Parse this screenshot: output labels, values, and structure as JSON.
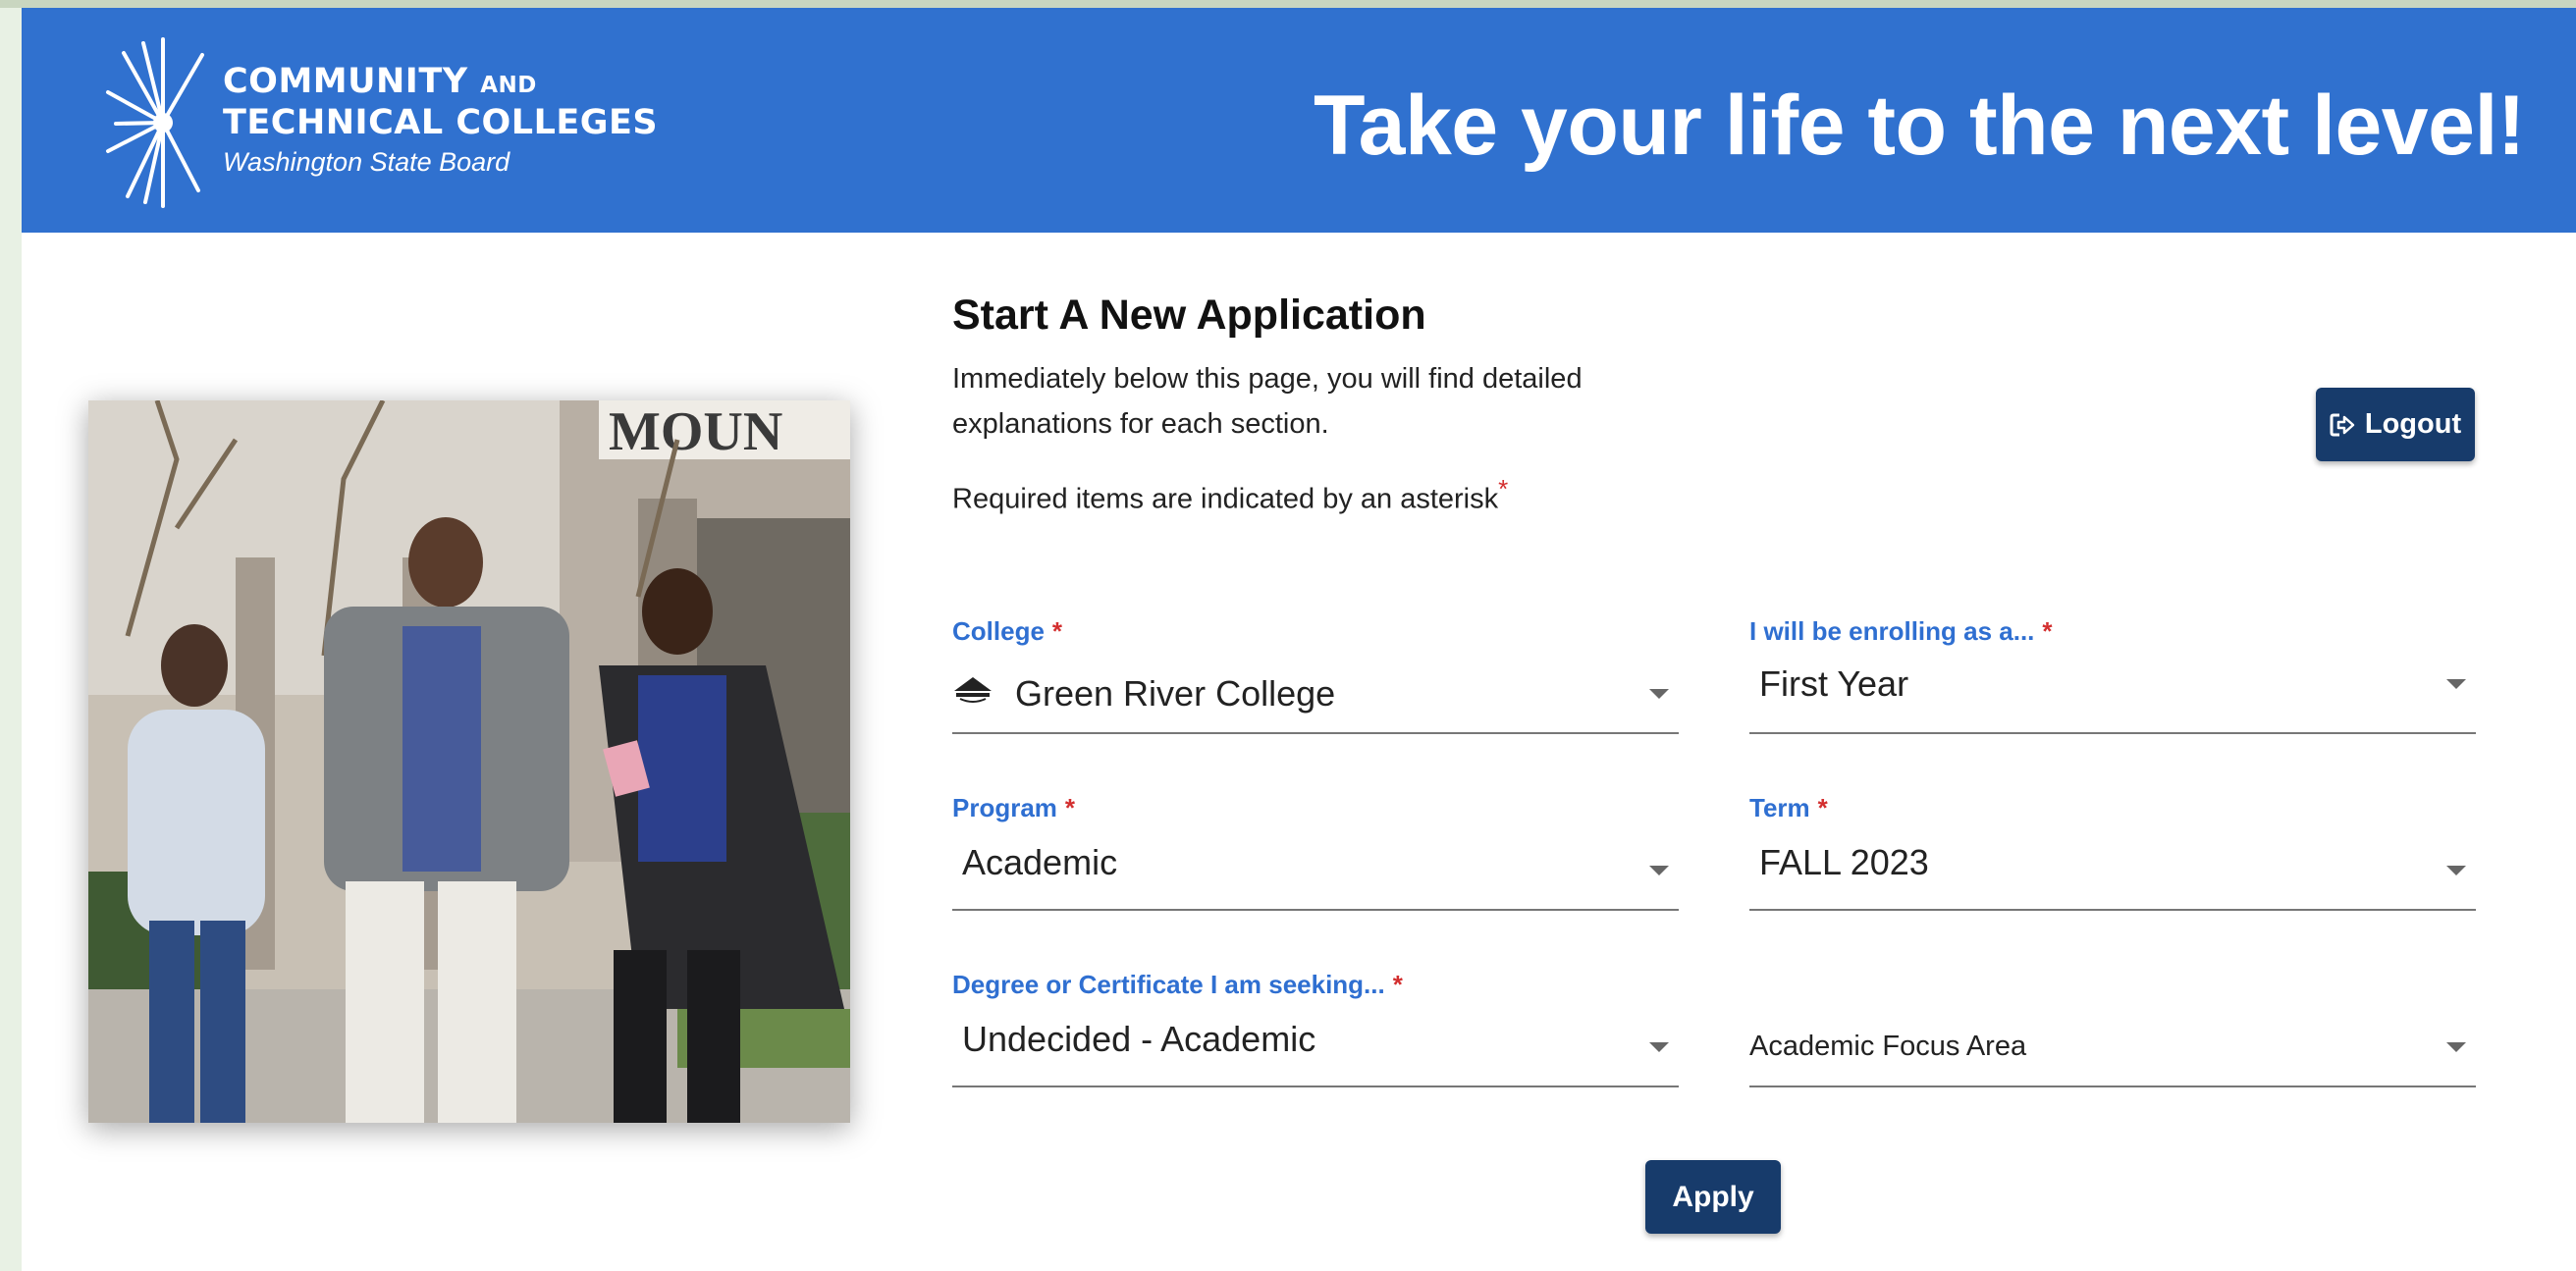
{
  "header": {
    "logo_line1": "COMMUNITY",
    "logo_line1_small": "AND",
    "logo_line2": "TECHNICAL COLLEGES",
    "logo_line3": "Washington State Board",
    "tagline": "Take your life to the next level!",
    "background_color": "#3071cf"
  },
  "photo": {
    "sign_text": "MOUN",
    "description_icon": "students-photo"
  },
  "main": {
    "title": "Start A New Application",
    "intro": "Immediately below this page, you will find detailed explanations for each section.",
    "required_note": "Required items are indicated by an asterisk",
    "asterisk": "*"
  },
  "logout": {
    "label": "Logout",
    "icon": "logout-icon"
  },
  "form": {
    "college": {
      "label": "College",
      "value": "Green River College",
      "icon": "college-logo-icon"
    },
    "enrolling": {
      "label": "I will be enrolling as a...",
      "value": "First Year"
    },
    "program": {
      "label": "Program",
      "value": "Academic"
    },
    "term": {
      "label": "Term",
      "value": "FALL 2023"
    },
    "degree": {
      "label": "Degree or Certificate I am seeking...",
      "value": "Undecided - Academic"
    },
    "focus": {
      "placeholder": "Academic Focus Area"
    }
  },
  "apply": {
    "label": "Apply"
  },
  "colors": {
    "accent": "#2f6fd1",
    "button": "#173b6b",
    "required": "#d32f2f"
  }
}
